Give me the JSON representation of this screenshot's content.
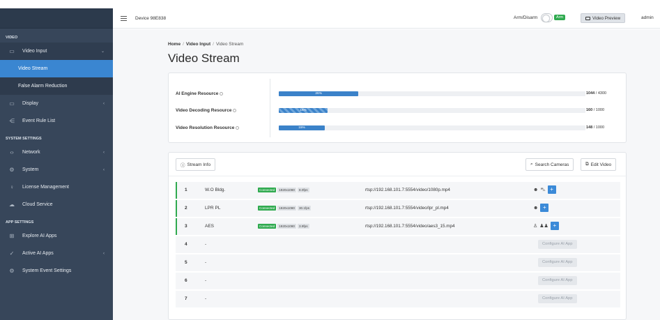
{
  "header": {
    "device": "Device 98E838",
    "arm_label": "Arm/Disarm",
    "arm_state": "Arm",
    "preview_label": "Video Preview",
    "user": "admin"
  },
  "sidebar": {
    "sections": [
      {
        "title": "VIDEO",
        "items": [
          {
            "label": "Video Input",
            "icon": "video-icon",
            "open": true,
            "children": [
              {
                "label": "Video Stream",
                "active": true
              },
              {
                "label": "False Alarm Reduction",
                "active": false
              }
            ]
          },
          {
            "label": "Display",
            "icon": "monitor-icon",
            "chevron": true
          },
          {
            "label": "Event Rule List",
            "icon": "rule-icon"
          }
        ]
      },
      {
        "title": "SYSTEM SETTINGS",
        "items": [
          {
            "label": "Network",
            "icon": "network-icon",
            "chevron": true
          },
          {
            "label": "System",
            "icon": "gear-icon",
            "chevron": true
          },
          {
            "label": "License Management",
            "icon": "key-icon"
          },
          {
            "label": "Cloud Service",
            "icon": "cloud-icon"
          }
        ]
      },
      {
        "title": "APP SETTINGS",
        "items": [
          {
            "label": "Explore AI Apps",
            "icon": "grid-icon"
          },
          {
            "label": "Active AI Apps",
            "icon": "check-icon",
            "chevron": true
          },
          {
            "label": "System Event Settings",
            "icon": "settings-icon"
          }
        ]
      }
    ]
  },
  "breadcrumb": {
    "home": "Home",
    "parent": "Video Input",
    "current": "Video Stream"
  },
  "page_title": "Video Stream",
  "resources": [
    {
      "label": "AI Engine Resource",
      "percent": 26,
      "percent_text": "26%",
      "used": "1044",
      "total": "/ 4300",
      "striped": false
    },
    {
      "label": "Video Decoding Resource",
      "percent": 16,
      "percent_text": "16%",
      "used": "160",
      "total": "/ 1000",
      "striped": true
    },
    {
      "label": "Video Resolution Resource",
      "percent": 15,
      "percent_text": "15%",
      "used": "148",
      "total": "/ 1000",
      "striped": false
    }
  ],
  "stream_toolbar": {
    "info_label": "Stream Info",
    "search_label": "Search Cameras",
    "edit_label": "Edit Video"
  },
  "streams": [
    {
      "index": "1",
      "name": "W.O Bldg.",
      "status": "Connected",
      "resolution": "1920x1080",
      "fps": "8.0fps",
      "url": "rtsp://192.168.101.7:5554/video/1080p.mp4",
      "apps": [
        "face-app-icon",
        "vehicle-app-icon"
      ]
    },
    {
      "index": "2",
      "name": "LPR PL",
      "status": "Connected",
      "resolution": "1920x1080",
      "fps": "30.1fps",
      "url": "rtsp://192.168.101.7:5554/video/lpr_pl.mp4",
      "apps": [
        "face-app-icon"
      ]
    },
    {
      "index": "3",
      "name": "AES",
      "status": "Connected",
      "resolution": "1920x1080",
      "fps": "3.9fps",
      "url": "rtsp://192.168.101.7:5554/video/aes3_15.mp4",
      "apps": [
        "person-app-icon",
        "crowd-app-icon"
      ]
    },
    {
      "index": "4",
      "name": "-",
      "configure_label": "Configure AI App"
    },
    {
      "index": "5",
      "name": "-",
      "configure_label": "Configure AI App"
    },
    {
      "index": "6",
      "name": "-",
      "configure_label": "Configure AI App"
    },
    {
      "index": "7",
      "name": "-",
      "configure_label": "Configure AI App"
    }
  ]
}
